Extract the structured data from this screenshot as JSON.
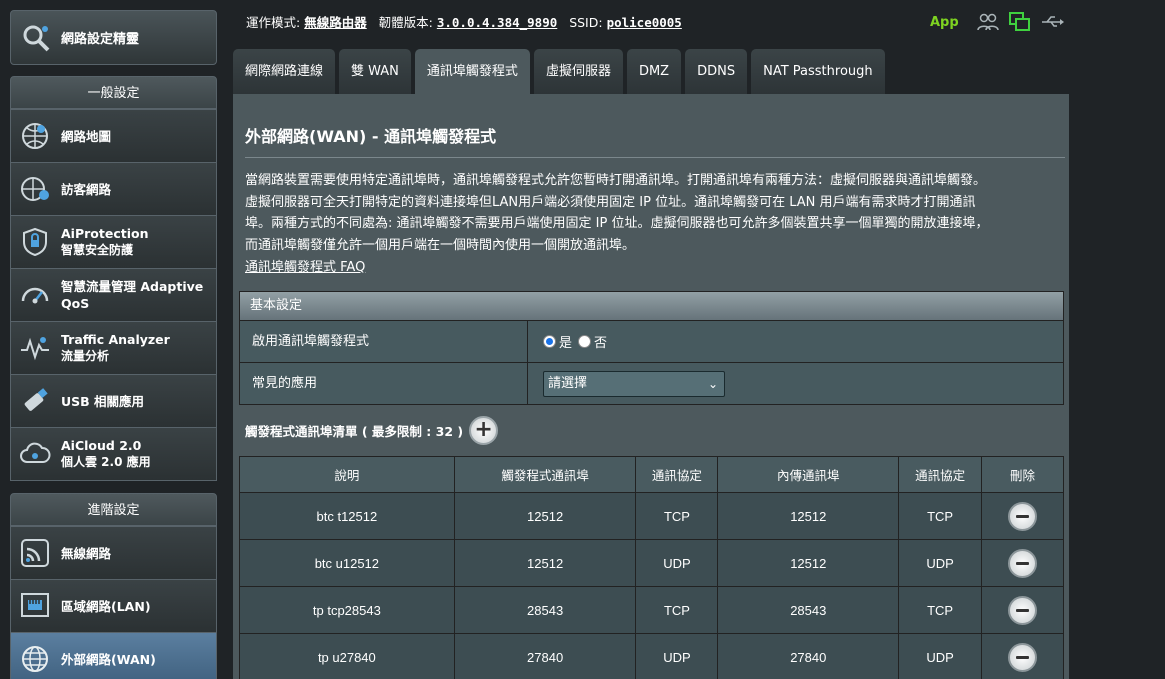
{
  "sidebar": {
    "wizard_label": "網路設定精靈",
    "general_header": "一般設定",
    "general_items": [
      {
        "label": "網路地圖",
        "sub": "",
        "icon": "network-map-icon"
      },
      {
        "label": "訪客網路",
        "sub": "",
        "icon": "guest-network-icon"
      },
      {
        "label": "AiProtection",
        "sub": "智慧安全防護",
        "icon": "aiprotection-shield-icon"
      },
      {
        "label": "智慧流量管理 Adaptive QoS",
        "sub": "",
        "icon": "qos-gauge-icon"
      },
      {
        "label": "Traffic Analyzer",
        "sub": "流量分析",
        "icon": "traffic-analyzer-icon"
      },
      {
        "label": "USB 相關應用",
        "sub": "",
        "icon": "usb-icon"
      },
      {
        "label": "AiCloud 2.0",
        "sub": "個人雲 2.0 應用",
        "icon": "cloud-icon"
      }
    ],
    "advanced_header": "進階設定",
    "advanced_items": [
      {
        "label": "無線網路",
        "icon": "wireless-icon"
      },
      {
        "label": "區域網路(LAN)",
        "icon": "lan-icon"
      },
      {
        "label": "外部網路(WAN)",
        "icon": "wan-globe-icon"
      }
    ]
  },
  "topbar": {
    "mode_label": "運作模式:",
    "mode_value": "無線路由器",
    "firmware_label": "韌體版本:",
    "firmware_value": "3.0.0.4.384_9890",
    "ssid_label": "SSID:",
    "ssid_value": "police0005",
    "app_label": "App"
  },
  "tabs": [
    "網際網路連線",
    "雙 WAN",
    "通訊埠觸發程式",
    "虛擬伺服器",
    "DMZ",
    "DDNS",
    "NAT Passthrough"
  ],
  "main": {
    "title": "外部網路(WAN) - 通訊埠觸發程式",
    "description_lines": [
      "當網路裝置需要使用特定通訊埠時，通訊埠觸發程式允許您暫時打開通訊埠。打開通訊埠有兩種方法：虛擬伺服器與通訊埠觸發。",
      "虛擬伺服器可全天打開特定的資料連接埠但LAN用戶端必須使用固定 IP 位址。通訊埠觸發可在 LAN 用戶端有需求時才打開通訊",
      "埠。兩種方式的不同處為: 通訊埠觸發不需要用戶端使用固定 IP 位址。虛擬伺服器也可允許多個裝置共享一個單獨的開放連接埠，",
      "而通訊埠觸發僅允許一個用戶端在一個時間內使用一個開放通訊埠。"
    ],
    "faq_link": "通訊埠觸發程式 FAQ",
    "basic": {
      "header": "基本設定",
      "enable_label": "啟用通訊埠觸發程式",
      "yes_label": "是",
      "no_label": "否",
      "enabled": true,
      "common_app_label": "常見的應用",
      "common_app_value": "請選擇"
    },
    "list_title": "觸發程式通訊埠清單 ( 最多限制 : 32 )",
    "table": {
      "headers": [
        "說明",
        "觸發程式通訊埠",
        "通訊協定",
        "內傳通訊埠",
        "通訊協定",
        "刪除"
      ],
      "rows": [
        [
          "btc t12512",
          "12512",
          "TCP",
          "12512",
          "TCP"
        ],
        [
          "btc u12512",
          "12512",
          "UDP",
          "12512",
          "UDP"
        ],
        [
          "tp tcp28543",
          "28543",
          "TCP",
          "28543",
          "TCP"
        ],
        [
          "tp u27840",
          "27840",
          "UDP",
          "27840",
          "UDP"
        ]
      ]
    }
  }
}
